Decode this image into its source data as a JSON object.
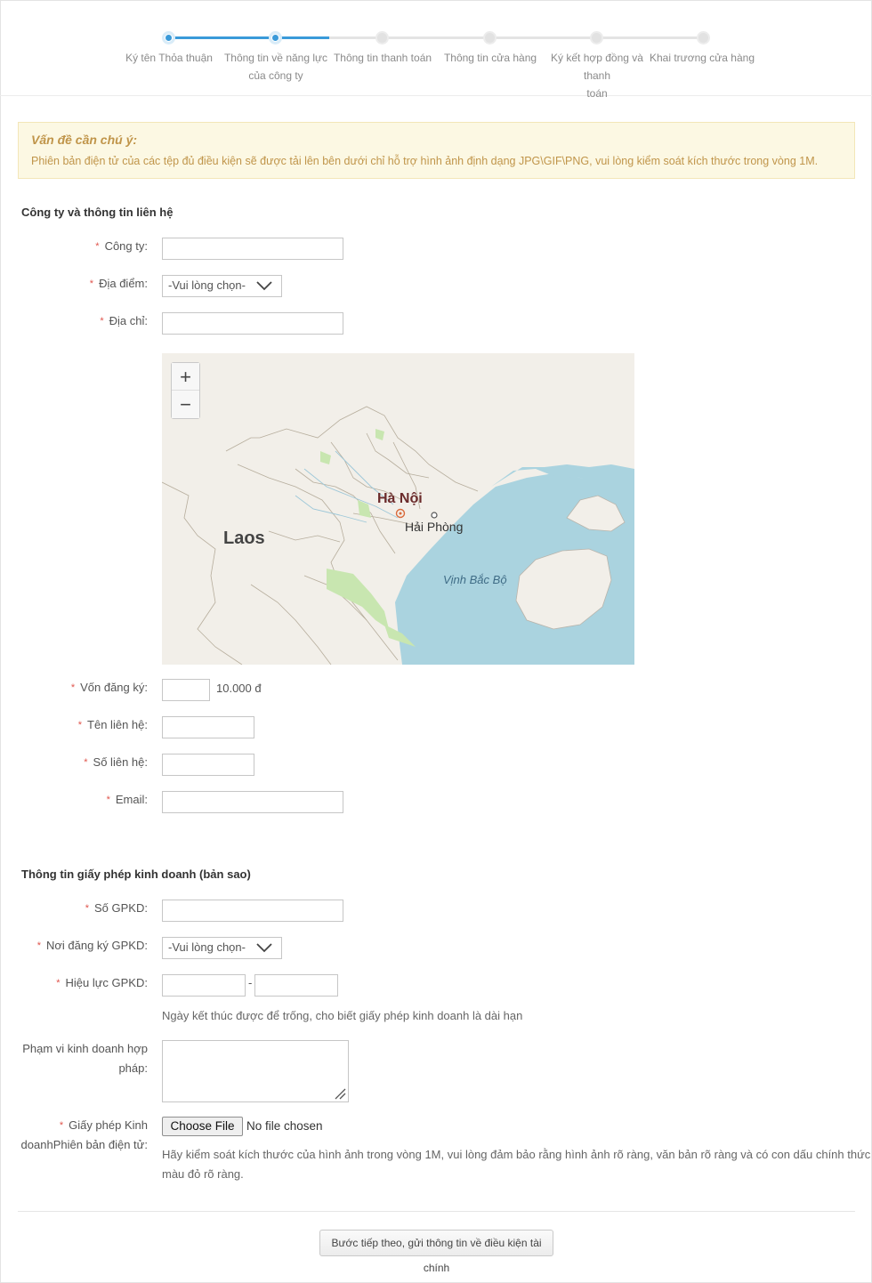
{
  "stepper": {
    "steps": [
      {
        "label": "Ký tên Thỏa thuận",
        "state": "done"
      },
      {
        "label": "Thông tin về năng lực\ncủa công ty",
        "state": "current"
      },
      {
        "label": "Thông tin thanh toán",
        "state": "pending"
      },
      {
        "label": "Thông tin cửa hàng",
        "state": "pending"
      },
      {
        "label": "Ký kết hợp đồng và thanh\ntoán",
        "state": "pending"
      },
      {
        "label": "Khai trương cửa hàng",
        "state": "pending"
      }
    ],
    "accent_color": "#3a9ad9"
  },
  "notice": {
    "title": "Vấn đề cần chú ý:",
    "text": "Phiên bản điện tử của các tệp đủ điều kiện sẽ được tải lên bên dưới chỉ hỗ trợ hình ảnh định dạng JPG\\GIF\\PNG, vui lòng kiểm soát kích thước trong vòng 1M."
  },
  "company": {
    "title": "Công ty và thông tin liên hệ",
    "company_label": "Công ty",
    "company_value": "",
    "location_label": "Địa điểm",
    "location_value": "-Vui lòng chọn-",
    "address_label": "Địa chỉ",
    "address_value": "",
    "capital_label": "Vốn đăng ký",
    "capital_value": "",
    "capital_unit": "10.000 đ",
    "contact_name_label": "Tên liên hệ",
    "contact_name_value": "",
    "contact_phone_label": "Số liên hệ",
    "contact_phone_value": "",
    "email_label": "Email",
    "email_value": ""
  },
  "map": {
    "zoom_in": "+",
    "zoom_out": "−",
    "label_hanoi": "Hà Nội",
    "label_haiphong": "Hải Phòng",
    "label_laos": "Laos",
    "label_gulf": "Vịnh Bắc Bộ",
    "colors": {
      "land": "#f2efe9",
      "sea": "#aad3df",
      "park": "#c8e6b0"
    }
  },
  "license": {
    "title": "Thông tin giấy phép kinh doanh (bản sao)",
    "number_label": "Số GPKD",
    "number_value": "",
    "place_label": "Nơi đăng ký GPKD",
    "place_value": "-Vui lòng chọn-",
    "validity_label": "Hiệu lực GPKD",
    "validity_from": "",
    "validity_sep": "-",
    "validity_to": "",
    "validity_help": "Ngày kết thúc được để trống, cho biết giấy phép kinh doanh là dài hạn",
    "scope_label_1": "Phạm vi kinh doanh hợp",
    "scope_label_2": "pháp",
    "file_label_1": "Giấy phép Kinh",
    "file_label_2": "doanhPhiên bản điện tử",
    "file_button": "Choose File",
    "file_status": "No file chosen",
    "file_help_1": "Hãy kiểm soát kích thước của hình ảnh trong vòng 1M, vui lòng đảm bảo rằng hình ảnh rõ ràng, văn bản rõ ràng và có con dấu chính thức",
    "file_help_2": "màu đỏ rõ ràng."
  },
  "footer": {
    "next_button": "Bước tiếp theo, gửi thông tin về điều kiện tài chính"
  }
}
